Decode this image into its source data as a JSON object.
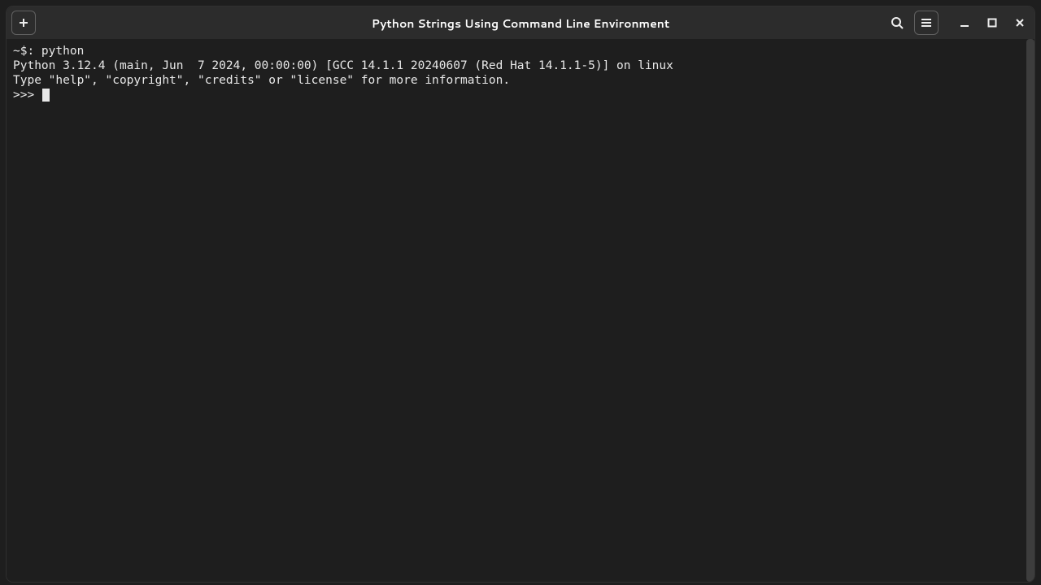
{
  "header": {
    "title": "Python Strings Using Command Line Environment"
  },
  "terminal": {
    "lines": [
      "~$: python",
      "Python 3.12.4 (main, Jun  7 2024, 00:00:00) [GCC 14.1.1 20240607 (Red Hat 14.1.1-5)] on linux",
      "Type \"help\", \"copyright\", \"credits\" or \"license\" for more information.",
      ">>> "
    ]
  },
  "icons": {
    "new_tab": "new-tab-icon",
    "search": "search-icon",
    "menu": "hamburger-menu-icon",
    "minimize": "minimize-icon",
    "maximize": "maximize-icon",
    "close": "close-icon"
  }
}
